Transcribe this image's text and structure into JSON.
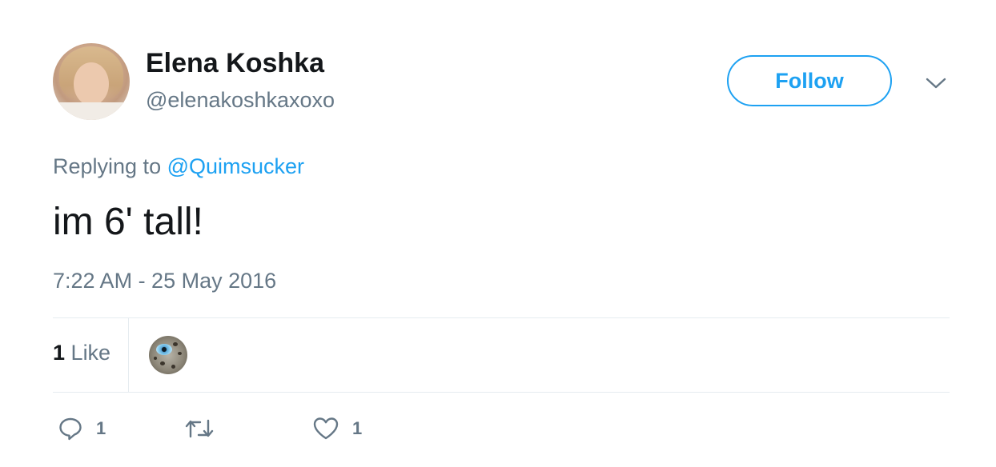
{
  "author": {
    "display_name": "Elena Koshka",
    "username": "@elenakoshkaxoxo"
  },
  "follow_button": {
    "label": "Follow"
  },
  "reply_context": {
    "prefix": "Replying to",
    "mention": "@Quimsucker"
  },
  "tweet": {
    "text": "im 6' tall!",
    "timestamp": "7:22 AM - 25 May 2016"
  },
  "stats": {
    "likes_count": "1",
    "likes_label": "Like"
  },
  "actions": {
    "reply_count": "1",
    "retweet_count": "",
    "like_count": "1"
  },
  "colors": {
    "accent": "#1da1f2",
    "secondary_text": "#657786",
    "primary_text": "#14171a",
    "divider": "#e6ecf0"
  },
  "icons": {
    "caret": "chevron-down-icon",
    "reply": "reply-icon",
    "retweet": "retweet-icon",
    "like": "heart-icon"
  }
}
